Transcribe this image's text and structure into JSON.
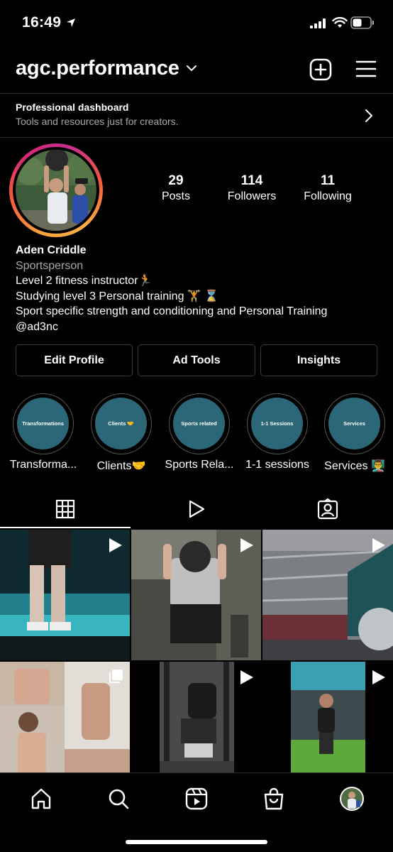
{
  "status_bar": {
    "time": "16:49"
  },
  "header": {
    "username": "agc.performance"
  },
  "dashboard": {
    "title": "Professional dashboard",
    "subtitle": "Tools and resources just for creators."
  },
  "stats": [
    {
      "value": "29",
      "label": "Posts"
    },
    {
      "value": "114",
      "label": "Followers"
    },
    {
      "value": "11",
      "label": "Following"
    }
  ],
  "bio": {
    "name": "Aden Criddle",
    "category": "Sportsperson",
    "lines": [
      "Level 2 fitness instructor🏃",
      "Studying level 3 Personal training 🏋 ⌛",
      "Sport specific strength and conditioning and Personal Training",
      "@ad3nc"
    ]
  },
  "buttons": {
    "edit_profile": "Edit Profile",
    "ad_tools": "Ad Tools",
    "insights": "Insights"
  },
  "highlights": [
    {
      "cover_text": "Transformations",
      "label": "Transforma..."
    },
    {
      "cover_text": "Clients 🤝",
      "label": "Clients🤝"
    },
    {
      "cover_text": "Sports related",
      "label": "Sports Rela..."
    },
    {
      "cover_text": "1-1 Sessions",
      "label": "1-1 sessions"
    },
    {
      "cover_text": "Services",
      "label": "Services 👨‍🏫"
    }
  ],
  "tabs": [
    "grid-icon",
    "reels-icon",
    "tagged-icon"
  ],
  "colors": {
    "background": "#000000",
    "secondary_text": "#a8a8a8",
    "highlight_cover": "#2b6777",
    "divider": "#262626"
  }
}
